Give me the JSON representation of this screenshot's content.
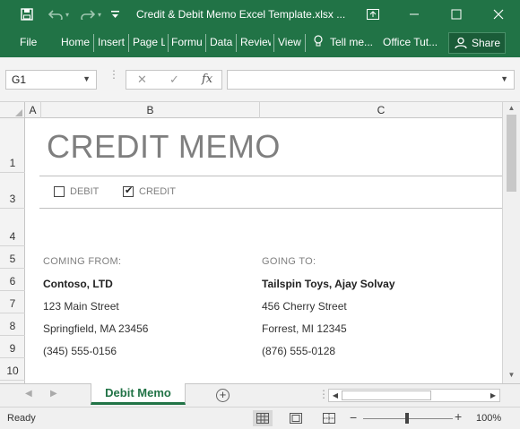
{
  "window": {
    "title": "Credit & Debit Memo Excel Template.xlsx ..."
  },
  "ribbon": {
    "tabs": [
      "File",
      "Home",
      "Insert",
      "Page L",
      "Formu",
      "Data",
      "Review",
      "View"
    ],
    "tell_me": "Tell me...",
    "office_tutorials": "Office Tut...",
    "share": "Share"
  },
  "formula_bar": {
    "name_box": "G1",
    "fx": "fx",
    "formula": ""
  },
  "columns": [
    "A",
    "B",
    "C"
  ],
  "rows": [
    "1",
    "3",
    "4",
    "5",
    "6",
    "7",
    "8",
    "9",
    "10"
  ],
  "memo": {
    "title": "CREDIT MEMO",
    "debit_label": "DEBIT",
    "debit_checked": false,
    "credit_label": "CREDIT",
    "credit_checked": true,
    "from": {
      "label": "COMING FROM:",
      "name": "Contoso, LTD",
      "street": "123 Main Street",
      "city": "Springfield, MA 23456",
      "phone": "(345) 555-0156"
    },
    "to": {
      "label": "GOING TO:",
      "name": "Tailspin Toys, Ajay Solvay",
      "street": "456 Cherry Street",
      "city": "Forrest, MI 12345",
      "phone": "(876) 555-0128"
    }
  },
  "sheet_tabs": [
    "Debit Memo"
  ],
  "status": {
    "text": "Ready",
    "zoom": "100%"
  },
  "colors": {
    "excel_green": "#217346",
    "title_gray": "#7f7f7f"
  }
}
